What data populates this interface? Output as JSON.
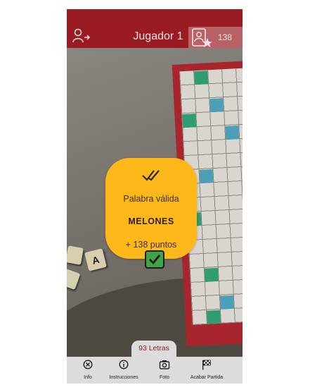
{
  "header": {
    "player_name": "Jugador 1",
    "score": "138",
    "logout_icon": "logout-icon",
    "profile_icon": "player-star-icon",
    "background_color": "#9b1b22"
  },
  "board_tiles": [
    "A"
  ],
  "popup": {
    "check_icon": "double-check-icon",
    "title": "Palabra válida",
    "word": "MELONES",
    "points": "+ 138 puntos",
    "background_color": "#ffb819",
    "confirm_icon": "checkbox-checked-icon",
    "confirm_color": "#3fa34a"
  },
  "letters_remaining": "93 Letras",
  "bottom_nav": [
    {
      "label": "Info",
      "icon": "close-circle-icon"
    },
    {
      "label": "Instrucciones",
      "icon": "info-icon"
    },
    {
      "label": "Foto",
      "icon": "camera-icon"
    },
    {
      "label": "Acabar Partida",
      "icon": "checkered-flag-icon"
    }
  ]
}
